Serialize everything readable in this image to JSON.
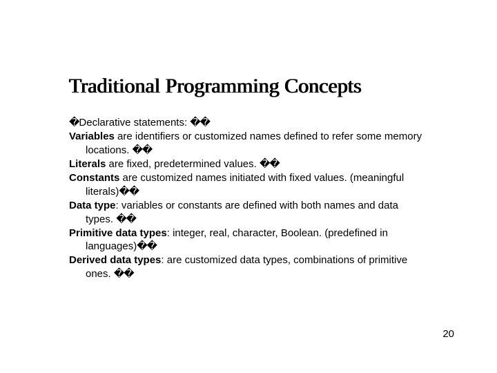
{
  "title": "Traditional Programming Concepts",
  "items": [
    {
      "prefix": "�",
      "text": "Declarative statements: ",
      "suffix": "��"
    },
    {
      "term": "Variables",
      "text": " are identifiers or customized names defined to refer some memory locations. ",
      "suffix": "��"
    },
    {
      "term": "Literals",
      "text": " are fixed, predetermined values. ",
      "suffix": "��"
    },
    {
      "term": "Constants",
      "text": " are customized names initiated with fixed values. (meaningful literals)",
      "suffix": "��"
    },
    {
      "term": "Data type",
      "text": ": variables or constants are defined with both names and data types. ",
      "suffix": "��"
    },
    {
      "term": "Primitive data types",
      "text": ": integer, real, character, Boolean. (predefined in languages)",
      "suffix": "��"
    },
    {
      "term": "Derived data types",
      "text": ": are customized data types, combinations of primitive ones. ",
      "suffix": "��"
    }
  ],
  "page_number": "20"
}
